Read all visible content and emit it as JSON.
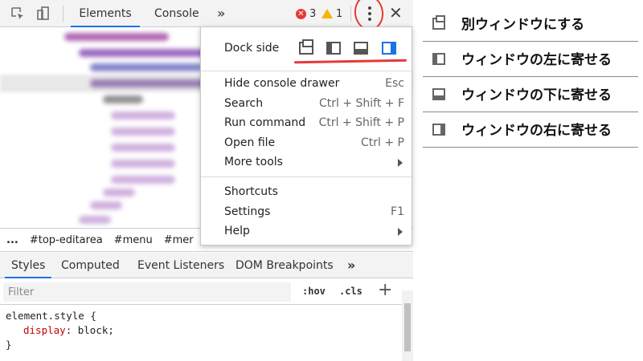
{
  "toolbar": {
    "tabs": [
      "Elements",
      "Console"
    ],
    "more_tabs": "»",
    "error_count": "3",
    "warning_count": "1"
  },
  "breadcrumb": [
    "...",
    "#top-editarea",
    "#menu",
    "#mer"
  ],
  "styles_panel": {
    "tabs": [
      "Styles",
      "Computed",
      "Event Listeners",
      "DOM Breakpoints"
    ],
    "more_tabs": "»",
    "filter_placeholder": "Filter",
    "hov": ":hov",
    "cls": ".cls",
    "add": "+",
    "code_selector": "element.style {",
    "code_prop": "display",
    "code_value": ": block;",
    "code_close": "}"
  },
  "menu": {
    "dock_label": "Dock side",
    "dock_selected": "right",
    "items_group1": [
      {
        "label": "Hide console drawer",
        "shortcut": "Esc",
        "submenu": false
      },
      {
        "label": "Search",
        "shortcut": "Ctrl + Shift + F",
        "submenu": false
      },
      {
        "label": "Run command",
        "shortcut": "Ctrl + Shift + P",
        "submenu": false
      },
      {
        "label": "Open file",
        "shortcut": "Ctrl + P",
        "submenu": false
      },
      {
        "label": "More tools",
        "shortcut": "",
        "submenu": true
      }
    ],
    "items_group2": [
      {
        "label": "Shortcuts",
        "shortcut": "",
        "submenu": false
      },
      {
        "label": "Settings",
        "shortcut": "F1",
        "submenu": false
      },
      {
        "label": "Help",
        "shortcut": "",
        "submenu": true
      }
    ]
  },
  "legend": [
    {
      "icon": "undock-icon",
      "text": "別ウィンドウにする"
    },
    {
      "icon": "dock-left-icon",
      "text": "ウィンドウの左に寄せる"
    },
    {
      "icon": "dock-bottom-icon",
      "text": "ウィンドウの下に寄せる"
    },
    {
      "icon": "dock-right-icon",
      "text": "ウィンドウの右に寄せる"
    }
  ],
  "colors": {
    "accent": "#1a73e8",
    "annotation_red": "#e53935",
    "warning": "#f4b400"
  }
}
